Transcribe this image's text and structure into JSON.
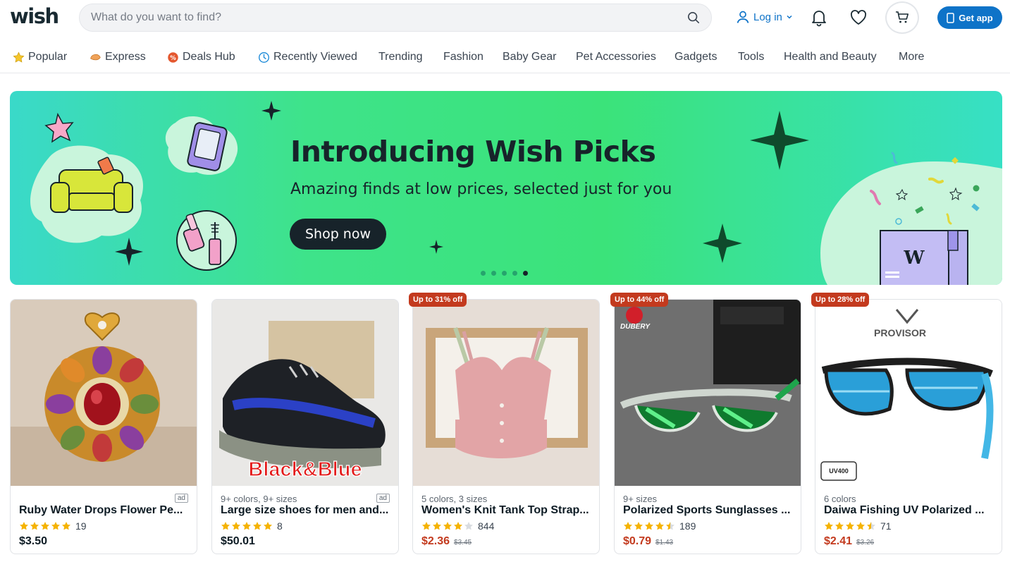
{
  "header": {
    "logo": "wish",
    "search_placeholder": "What do you want to find?",
    "login_label": "Log in",
    "get_app_label": "Get app"
  },
  "nav": {
    "items": [
      {
        "label": "Popular",
        "icon": "star-icon"
      },
      {
        "label": "Express",
        "icon": "express-icon"
      },
      {
        "label": "Deals Hub",
        "icon": "deals-icon"
      },
      {
        "label": "Recently Viewed",
        "icon": "clock-icon"
      },
      {
        "label": "Trending"
      },
      {
        "label": "Fashion"
      },
      {
        "label": "Baby Gear"
      },
      {
        "label": "Pet Accessories"
      },
      {
        "label": "Gadgets"
      },
      {
        "label": "Tools"
      },
      {
        "label": "Health and Beauty"
      },
      {
        "label": "More"
      }
    ]
  },
  "banner": {
    "title": "Introducing Wish Picks",
    "subtitle": "Amazing finds at low prices, selected just for you",
    "cta": "Shop now",
    "slide_count": 5,
    "active_slide": 5,
    "colors": {
      "start": "#3ad9c9",
      "mid": "#3ee38a",
      "end": "#37e0c5",
      "ink": "#17232a"
    }
  },
  "products": [
    {
      "meta": "",
      "ad": "ad",
      "title": "Ruby Water Drops Flower Pe...",
      "rating": 5,
      "reviews": "19",
      "price": "$3.50",
      "old_price": "",
      "badge": "",
      "image": "pendant-image"
    },
    {
      "meta": "9+ colors, 9+ sizes",
      "ad": "ad",
      "title": "Large size shoes for men and...",
      "rating": 5,
      "reviews": "8",
      "price": "$50.01",
      "old_price": "",
      "badge": "",
      "image": "shoe-image",
      "image_text": "Black&Blue"
    },
    {
      "meta": "5 colors, 3 sizes",
      "ad": "",
      "title": "Women's Knit Tank Top Strap...",
      "rating": 4,
      "reviews": "844",
      "price": "$2.36",
      "old_price": "$3.45",
      "badge": "Up to 31% off",
      "image": "tank-top-image"
    },
    {
      "meta": "9+ sizes",
      "ad": "",
      "title": "Polarized Sports Sunglasses ...",
      "rating": 4.5,
      "reviews": "189",
      "price": "$0.79",
      "old_price": "$1.43",
      "badge": "Up to 44% off",
      "image": "sunglasses-image",
      "image_text": "DUBERY"
    },
    {
      "meta": "6 colors",
      "ad": "",
      "title": "Daiwa Fishing UV Polarized ...",
      "rating": 4.5,
      "reviews": "71",
      "price": "$2.41",
      "old_price": "$3.26",
      "badge": "Up to 28% off",
      "image": "fishing-glasses-image",
      "image_text": "PROVISOR",
      "image_text_2": "UV400"
    }
  ],
  "colors": {
    "accent": "#0e73c8",
    "sale": "#c33a1e",
    "star": "#f5b301"
  }
}
